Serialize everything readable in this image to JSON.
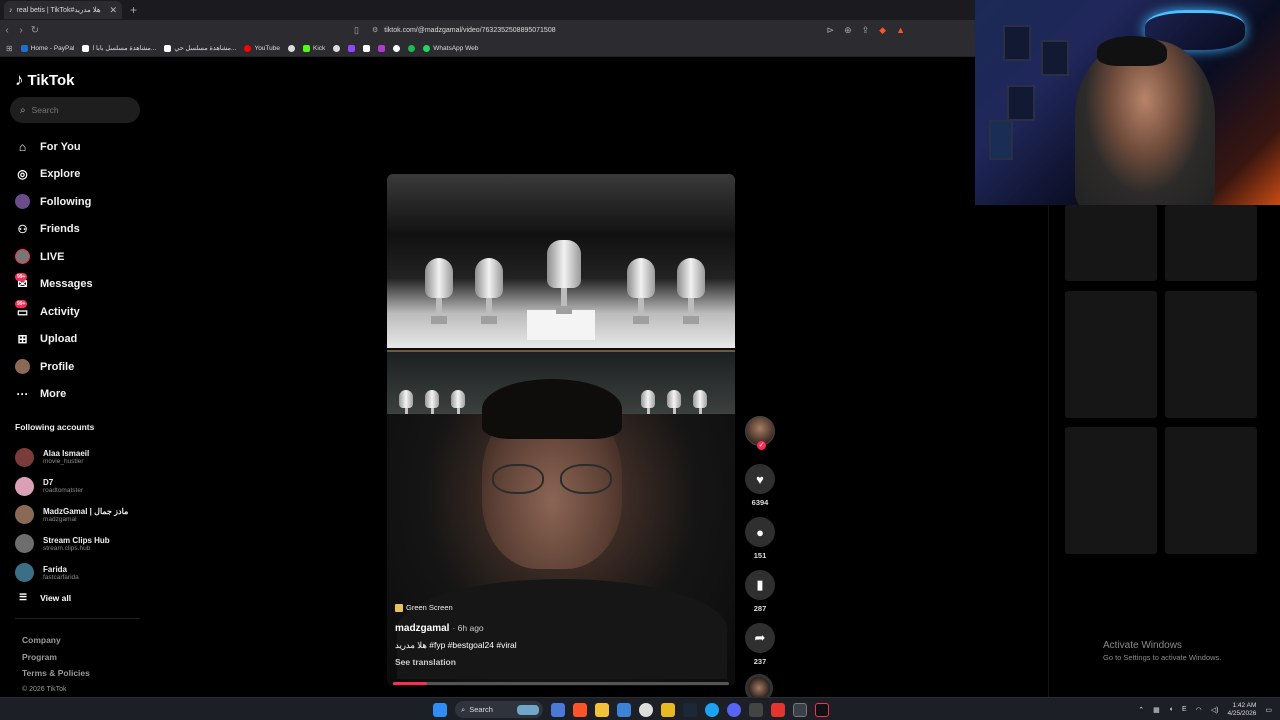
{
  "browser": {
    "tab_title": "real betis | TikTok#هلا مدريد",
    "url": "tiktok.com/@madzgamal/video/7632352508895071508",
    "bookmarks": [
      {
        "label": "Home - PayPal",
        "color": "#1f6fd1"
      },
      {
        "label": "مشاهدة مسلسل بابا ا...",
        "color": "#ffffff"
      },
      {
        "label": "مشاهدة مسلسل حي...",
        "color": "#ffffff"
      },
      {
        "label": "YouTube",
        "color": "#ff0000"
      },
      {
        "label": "Kick",
        "color": "#53fc18"
      },
      {
        "label": "WhatsApp Web",
        "color": "#25d366"
      }
    ]
  },
  "tiktok": {
    "logo": "TikTok",
    "search_placeholder": "Search",
    "nav": [
      {
        "label": "For You",
        "icon": "home-icon",
        "glyph": "⌂"
      },
      {
        "label": "Explore",
        "icon": "compass-icon",
        "glyph": "◎"
      },
      {
        "label": "Following",
        "icon": "following-avatar-icon",
        "glyph": "◉"
      },
      {
        "label": "Friends",
        "icon": "friends-icon",
        "glyph": "👥"
      },
      {
        "label": "LIVE",
        "icon": "live-icon",
        "glyph": "●"
      },
      {
        "label": "Messages",
        "icon": "messages-icon",
        "glyph": "✉",
        "badge": "99+"
      },
      {
        "label": "Activity",
        "icon": "activity-icon",
        "glyph": "▭",
        "badge": "99+"
      },
      {
        "label": "Upload",
        "icon": "upload-icon",
        "glyph": "⊞"
      },
      {
        "label": "Profile",
        "icon": "profile-icon",
        "glyph": "●"
      },
      {
        "label": "More",
        "icon": "more-icon",
        "glyph": "···"
      }
    ],
    "following_title": "Following accounts",
    "accounts": [
      {
        "name": "Alaa Ismaeil",
        "handle": "movie_hustler",
        "color": "#7a3b3b"
      },
      {
        "name": "D7",
        "handle": "roadtomatster",
        "color": "#d9a0b6"
      },
      {
        "name": "MadzGamal | مادز جمال",
        "handle": "madzgamal",
        "color": "#8a6a55"
      },
      {
        "name": "Stream Clips Hub",
        "handle": "stream.clips.hub",
        "color": "#6e6e6e"
      },
      {
        "name": "Farida",
        "handle": "fastcarfarida",
        "color": "#3a6f86"
      }
    ],
    "view_all": "View all",
    "footer": {
      "company": "Company",
      "program": "Program",
      "terms": "Terms & Policies",
      "copyright": "© 2026 TikTok"
    }
  },
  "video": {
    "effect_label": "Green Screen",
    "author": "madzgamal",
    "time_ago": "· 6h ago",
    "caption": "هلا مدريد #fyp #bestgoal24 #viral",
    "see_translation": "See translation",
    "progress": 0.1,
    "likes": "6394",
    "comments": "151",
    "saves": "287",
    "shares": "237"
  },
  "system": {
    "activate_title": "Activate Windows",
    "activate_sub": "Go to Settings to activate Windows.",
    "taskbar_search": "Search",
    "time": "1:42 AM",
    "date": "4/25/2026",
    "lang": "E"
  }
}
